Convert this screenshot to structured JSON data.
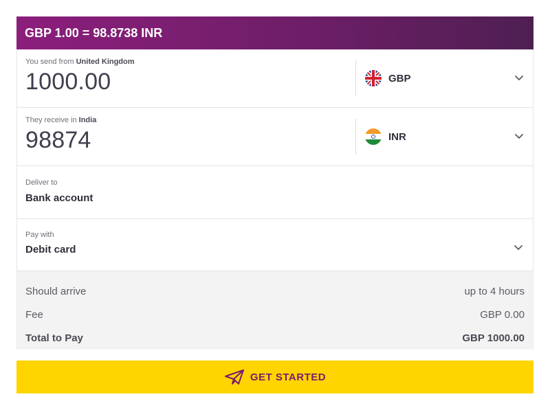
{
  "rate_banner": "GBP 1.00 = 98.8738 INR",
  "send": {
    "label_prefix": "You send from",
    "country": "United Kingdom",
    "amount": "1000.00",
    "currency": "GBP",
    "flag_icon": "uk-flag-icon"
  },
  "receive": {
    "label_prefix": "They receive in",
    "country": "India",
    "amount": "98874",
    "currency": "INR",
    "flag_icon": "india-flag-icon"
  },
  "deliver": {
    "label": "Deliver to",
    "value": "Bank account"
  },
  "pay": {
    "label": "Pay with",
    "value": "Debit card"
  },
  "summary": {
    "arrive_label": "Should arrive",
    "arrive_value": "up to 4 hours",
    "fee_label": "Fee",
    "fee_value": "GBP 0.00",
    "total_label": "Total to Pay",
    "total_value": "GBP 1000.00"
  },
  "cta": {
    "label": "GET STARTED",
    "icon": "paper-plane-icon"
  },
  "colors": {
    "banner_start": "#8c1e7c",
    "banner_end": "#4f1f52",
    "cta_background": "#ffd500",
    "cta_text": "#7a1a6e"
  }
}
